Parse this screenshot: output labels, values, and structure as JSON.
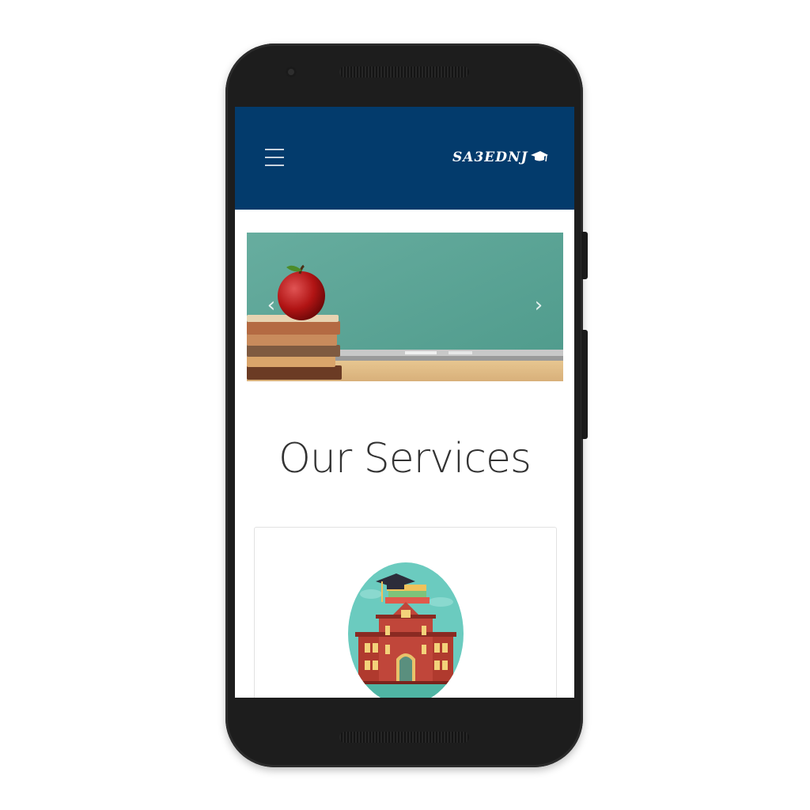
{
  "header": {
    "brand": "SA3EDNJ",
    "menu_icon": "hamburger-menu-icon",
    "background_color": "#033b6c"
  },
  "carousel": {
    "prev_icon": "chevron-left-icon",
    "next_icon": "chevron-right-icon",
    "prev_glyph": "‹",
    "next_glyph": "›"
  },
  "services": {
    "title": "Our Services",
    "cards": [
      {
        "image": "school-building-graduation-cap-illustration"
      }
    ]
  }
}
